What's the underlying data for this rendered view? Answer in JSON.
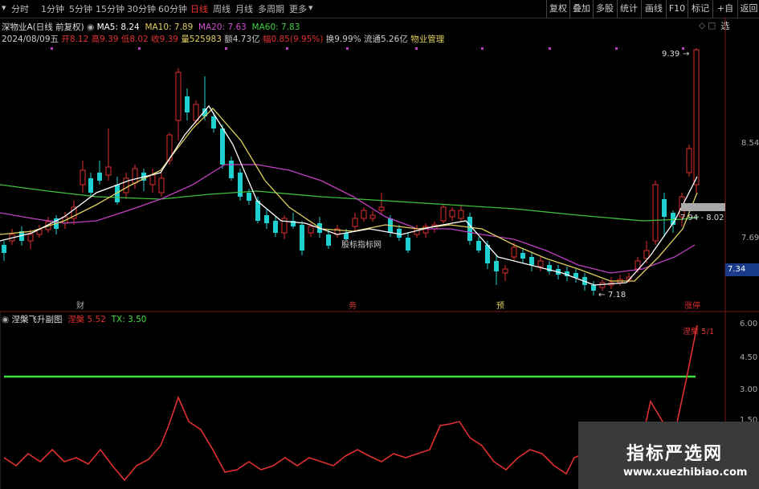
{
  "toolbar": {
    "periods": [
      "分时",
      "1分钟",
      "5分钟",
      "15分钟",
      "30分钟",
      "60分钟",
      "日线",
      "周线",
      "月线",
      "多周期",
      "更多"
    ],
    "active_period": "日线",
    "right_buttons": [
      "复权",
      "叠加",
      "多股",
      "统计",
      "画线",
      "F10",
      "标记",
      "+自选",
      "返回"
    ]
  },
  "header": {
    "stock_name": "深物业A(日线 前复权)",
    "ma5": "MA5: 8.24",
    "ma10": "MA10: 7.89",
    "ma20": "MA20: 7.63",
    "ma60": "MA60: 7.83",
    "date": "2024/08/09五",
    "open": "开8.12",
    "high": "高9.39",
    "low": "低8.02",
    "close": "收9.39",
    "volume": "量525983",
    "amount": "额4.73亿",
    "change": "幅0.85(9.95%)",
    "turnover": "换9.99%",
    "float": "流通5.26亿",
    "industry": "物业管理"
  },
  "price_axis": {
    "high_label": "8.54",
    "mid_label": "7.69",
    "current_label": "7.34"
  },
  "annotations": {
    "peak": "9.39",
    "range": "7.94 - 8.02",
    "low": "7.18",
    "watermark_center": "股标指标网"
  },
  "event_markers": [
    "财",
    "务",
    "预",
    "涨停"
  ],
  "indicator": {
    "name": "涅槃飞升副图",
    "series1_label": "涅槃",
    "series1_value": "5.52",
    "series2_label": "TX:",
    "series2_value": "3.50",
    "tail_label": "涅槃 5/1",
    "axis": [
      "6.00",
      "4.50",
      "3.00",
      "1.50"
    ]
  },
  "watermark": {
    "line1": "指标严选网",
    "line2": "www.xuezhibiao.com"
  },
  "colors": {
    "up": "#e03030",
    "down": "#20d0d0",
    "ma5": "#ffffff",
    "ma10": "#e0d060",
    "ma20": "#c040c0",
    "ma60": "#40c040",
    "indicator_line": "#e03030",
    "tx_line": "#40e040"
  }
}
